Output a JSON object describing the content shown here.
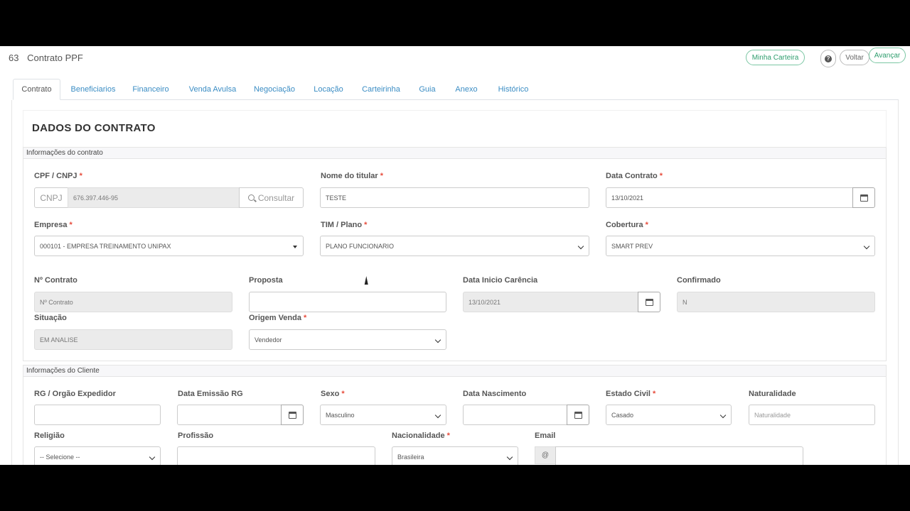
{
  "header": {
    "number": "63",
    "title": "Contrato PPF",
    "minha_carteira": "Minha Carteira",
    "help_icon": "help-icon",
    "voltar": "Voltar",
    "avancar": "Avançar"
  },
  "tabs": [
    "Contrato",
    "Beneficiarios",
    "Financeiro",
    "Venda Avulsa",
    "Negociação",
    "Locação",
    "Carteirinha",
    "Guia",
    "Anexo",
    "Histórico"
  ],
  "section_title": "DADOS DO CONTRATO",
  "contrato": {
    "legend": "Informações do contrato",
    "cpf_label": "CPF / CNPJ",
    "cpf_type": "CNPJ",
    "cpf_value": "676.397.446-95",
    "consultar": "Consultar",
    "nome_label": "Nome do titular",
    "nome_value": "TESTE",
    "data_label": "Data Contrato",
    "data_value": "13/10/2021",
    "empresa_label": "Empresa",
    "empresa_value": "000101 - EMPRESA TREINAMENTO UNIPAX",
    "tim_label": "TIM / Plano",
    "tim_value": "PLANO FUNCIONARIO",
    "cobertura_label": "Cobertura",
    "cobertura_value": "SMART PREV",
    "ncontrato_label": "Nº Contrato",
    "ncontrato_placeholder": "Nº Contrato",
    "proposta_label": "Proposta",
    "carencia_label": "Data Inicio Carência",
    "carencia_value": "13/10/2021",
    "confirmado_label": "Confirmado",
    "confirmado_value": "N",
    "situacao_label": "Situação",
    "situacao_value": "EM ANALISE",
    "origem_label": "Origem Venda",
    "origem_value": "Vendedor"
  },
  "cliente": {
    "legend": "Informações do Cliente",
    "rg_label": "RG / Orgão Expedidor",
    "emissao_label": "Data Emissão RG",
    "sexo_label": "Sexo",
    "sexo_value": "Masculino",
    "nasc_label": "Data Nascimento",
    "civil_label": "Estado Civil",
    "civil_value": "Casado",
    "natural_label": "Naturalidade",
    "natural_placeholder": "Naturalidade",
    "religiao_label": "Religião",
    "religiao_value": "-- Selecione --",
    "profissao_label": "Profissão",
    "nacionalidade_label": "Nacionalidade",
    "nacionalidade_value": "Brasileira",
    "email_label": "Email",
    "email_addon": "@"
  }
}
